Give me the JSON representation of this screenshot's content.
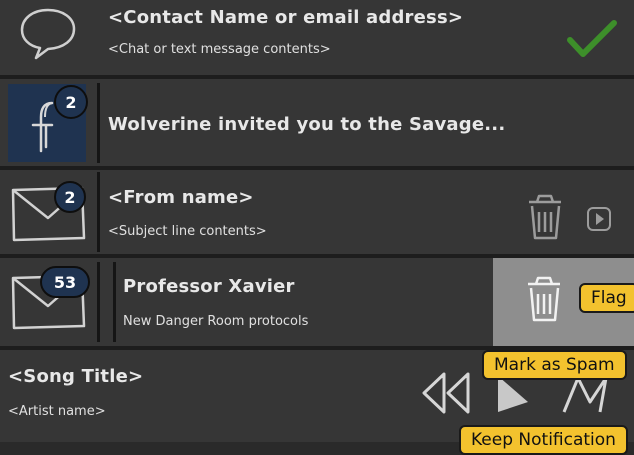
{
  "notifications": [
    {
      "type": "chat",
      "icon": "chat-bubble-icon",
      "title": "<Contact Name or email address>",
      "subtitle": "<Chat or text message contents>",
      "action_icon": "checkmark-icon"
    },
    {
      "type": "facebook",
      "icon": "facebook-icon",
      "badge": "2",
      "title": "Wolverine invited you to the Savage..."
    },
    {
      "type": "email",
      "icon": "envelope-icon",
      "badge": "2",
      "title": "<From name>",
      "subtitle": "<Subject line contents>",
      "action_icons": [
        "trash-icon",
        "play-button-icon"
      ]
    },
    {
      "type": "email",
      "icon": "envelope-icon",
      "badge": "53",
      "title": "Professor Xavier",
      "subtitle": "New Danger Room protocols",
      "swiped": true,
      "action_icon": "trash-icon"
    },
    {
      "type": "music",
      "title": "<Song Title>",
      "subtitle": "<Artist name>",
      "controls": [
        "rewind-icon",
        "play-icon",
        "skip-icon"
      ]
    }
  ],
  "callouts": {
    "flag": "Flag",
    "mark_spam": "Mark as Spam",
    "keep": "Keep Notification"
  },
  "colors": {
    "background": "#363636",
    "separator": "#1d1d1d",
    "swipe_panel": "#8e8e8e",
    "facebook_tile": "#1f3350",
    "badge": "#1f3350",
    "check": "#3d8f2a",
    "callout": "#f3c22e"
  }
}
